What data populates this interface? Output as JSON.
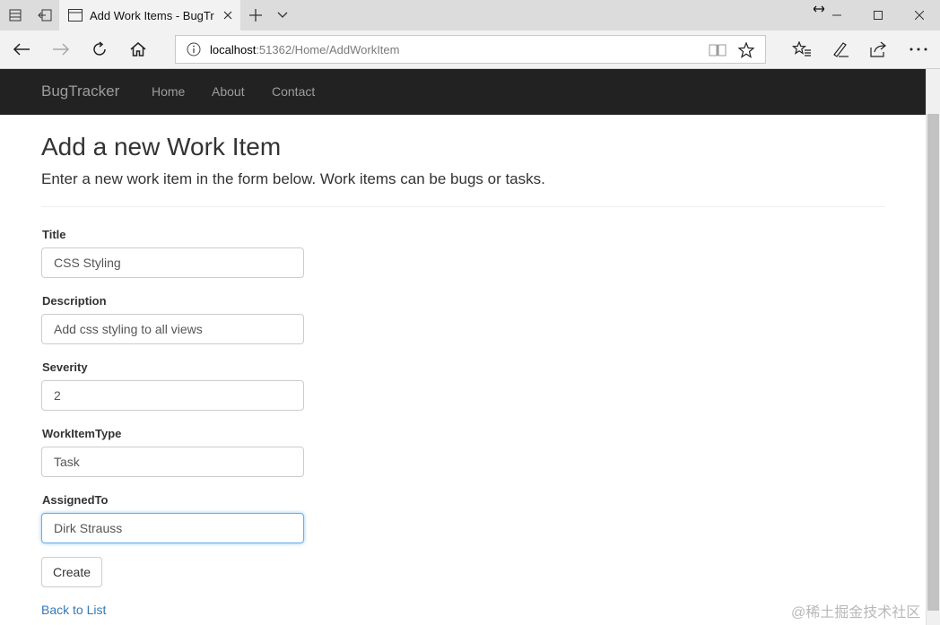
{
  "browser": {
    "tab_title": "Add Work Items - BugTr",
    "url_host": "localhost",
    "url_path": ":51362/Home/AddWorkItem"
  },
  "site": {
    "brand": "BugTracker",
    "nav": [
      "Home",
      "About",
      "Contact"
    ]
  },
  "page": {
    "title": "Add a new Work Item",
    "subtitle": "Enter a new work item in the form below. Work items can be bugs or tasks."
  },
  "form": {
    "fields": [
      {
        "label": "Title",
        "value": "CSS Styling"
      },
      {
        "label": "Description",
        "value": "Add css styling to all views"
      },
      {
        "label": "Severity",
        "value": "2"
      },
      {
        "label": "WorkItemType",
        "value": "Task"
      },
      {
        "label": "AssignedTo",
        "value": "Dirk Strauss"
      }
    ],
    "submit_label": "Create",
    "back_link": "Back to List"
  },
  "watermark": "@稀土掘金技术社区",
  "colors": {
    "navbar_bg": "#222222",
    "link": "#337ab7",
    "focus_border": "#66afe9"
  }
}
